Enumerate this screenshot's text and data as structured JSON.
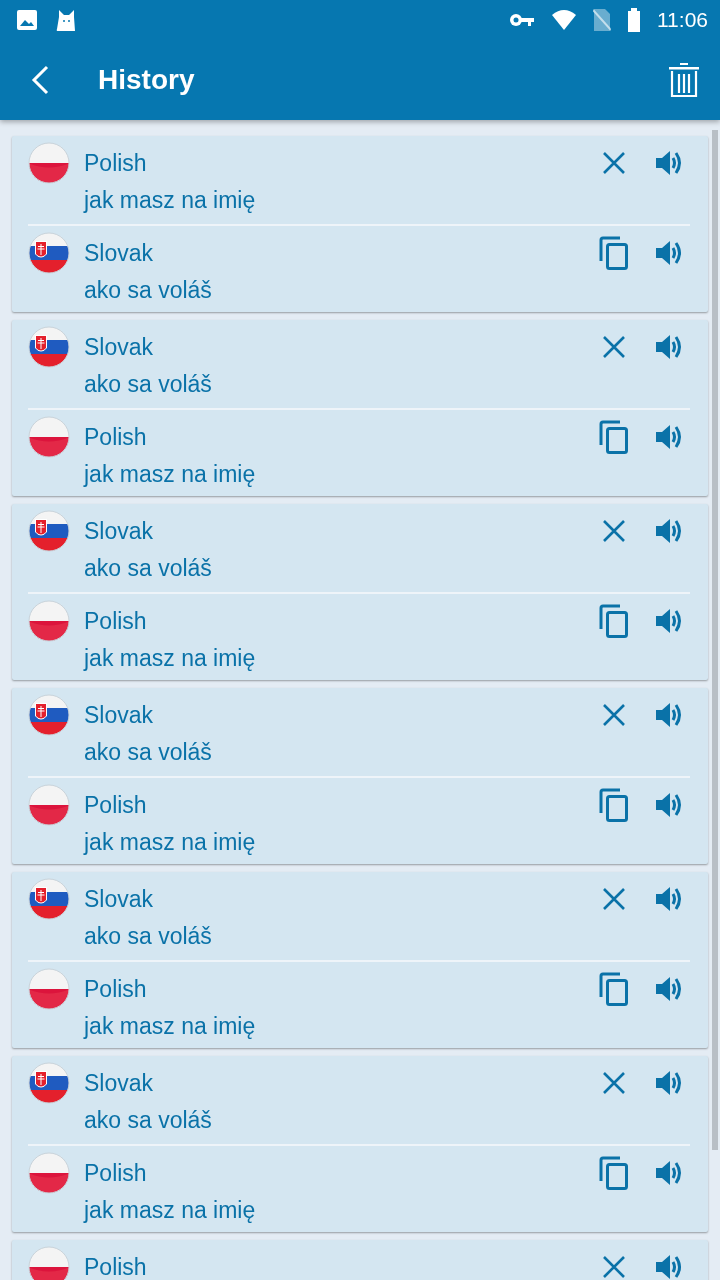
{
  "status_bar": {
    "time": "11:06"
  },
  "app_bar": {
    "title": "History"
  },
  "entries": [
    {
      "source": {
        "kind": "polish",
        "language": "Polish",
        "text": "jak masz na imię"
      },
      "target": {
        "kind": "slovak",
        "language": "Slovak",
        "text": "ako sa voláš"
      }
    },
    {
      "source": {
        "kind": "slovak",
        "language": "Slovak",
        "text": "ako sa voláš"
      },
      "target": {
        "kind": "polish",
        "language": "Polish",
        "text": "jak masz na imię"
      }
    },
    {
      "source": {
        "kind": "slovak",
        "language": "Slovak",
        "text": "ako sa voláš"
      },
      "target": {
        "kind": "polish",
        "language": "Polish",
        "text": "jak masz na imię"
      }
    },
    {
      "source": {
        "kind": "slovak",
        "language": "Slovak",
        "text": "ako sa voláš"
      },
      "target": {
        "kind": "polish",
        "language": "Polish",
        "text": "jak masz na imię"
      }
    },
    {
      "source": {
        "kind": "slovak",
        "language": "Slovak",
        "text": "ako sa voláš"
      },
      "target": {
        "kind": "polish",
        "language": "Polish",
        "text": "jak masz na imię"
      }
    },
    {
      "source": {
        "kind": "slovak",
        "language": "Slovak",
        "text": "ako sa voláš"
      },
      "target": {
        "kind": "polish",
        "language": "Polish",
        "text": "jak masz na imię"
      }
    },
    {
      "source": {
        "kind": "polish",
        "language": "Polish"
      }
    }
  ]
}
